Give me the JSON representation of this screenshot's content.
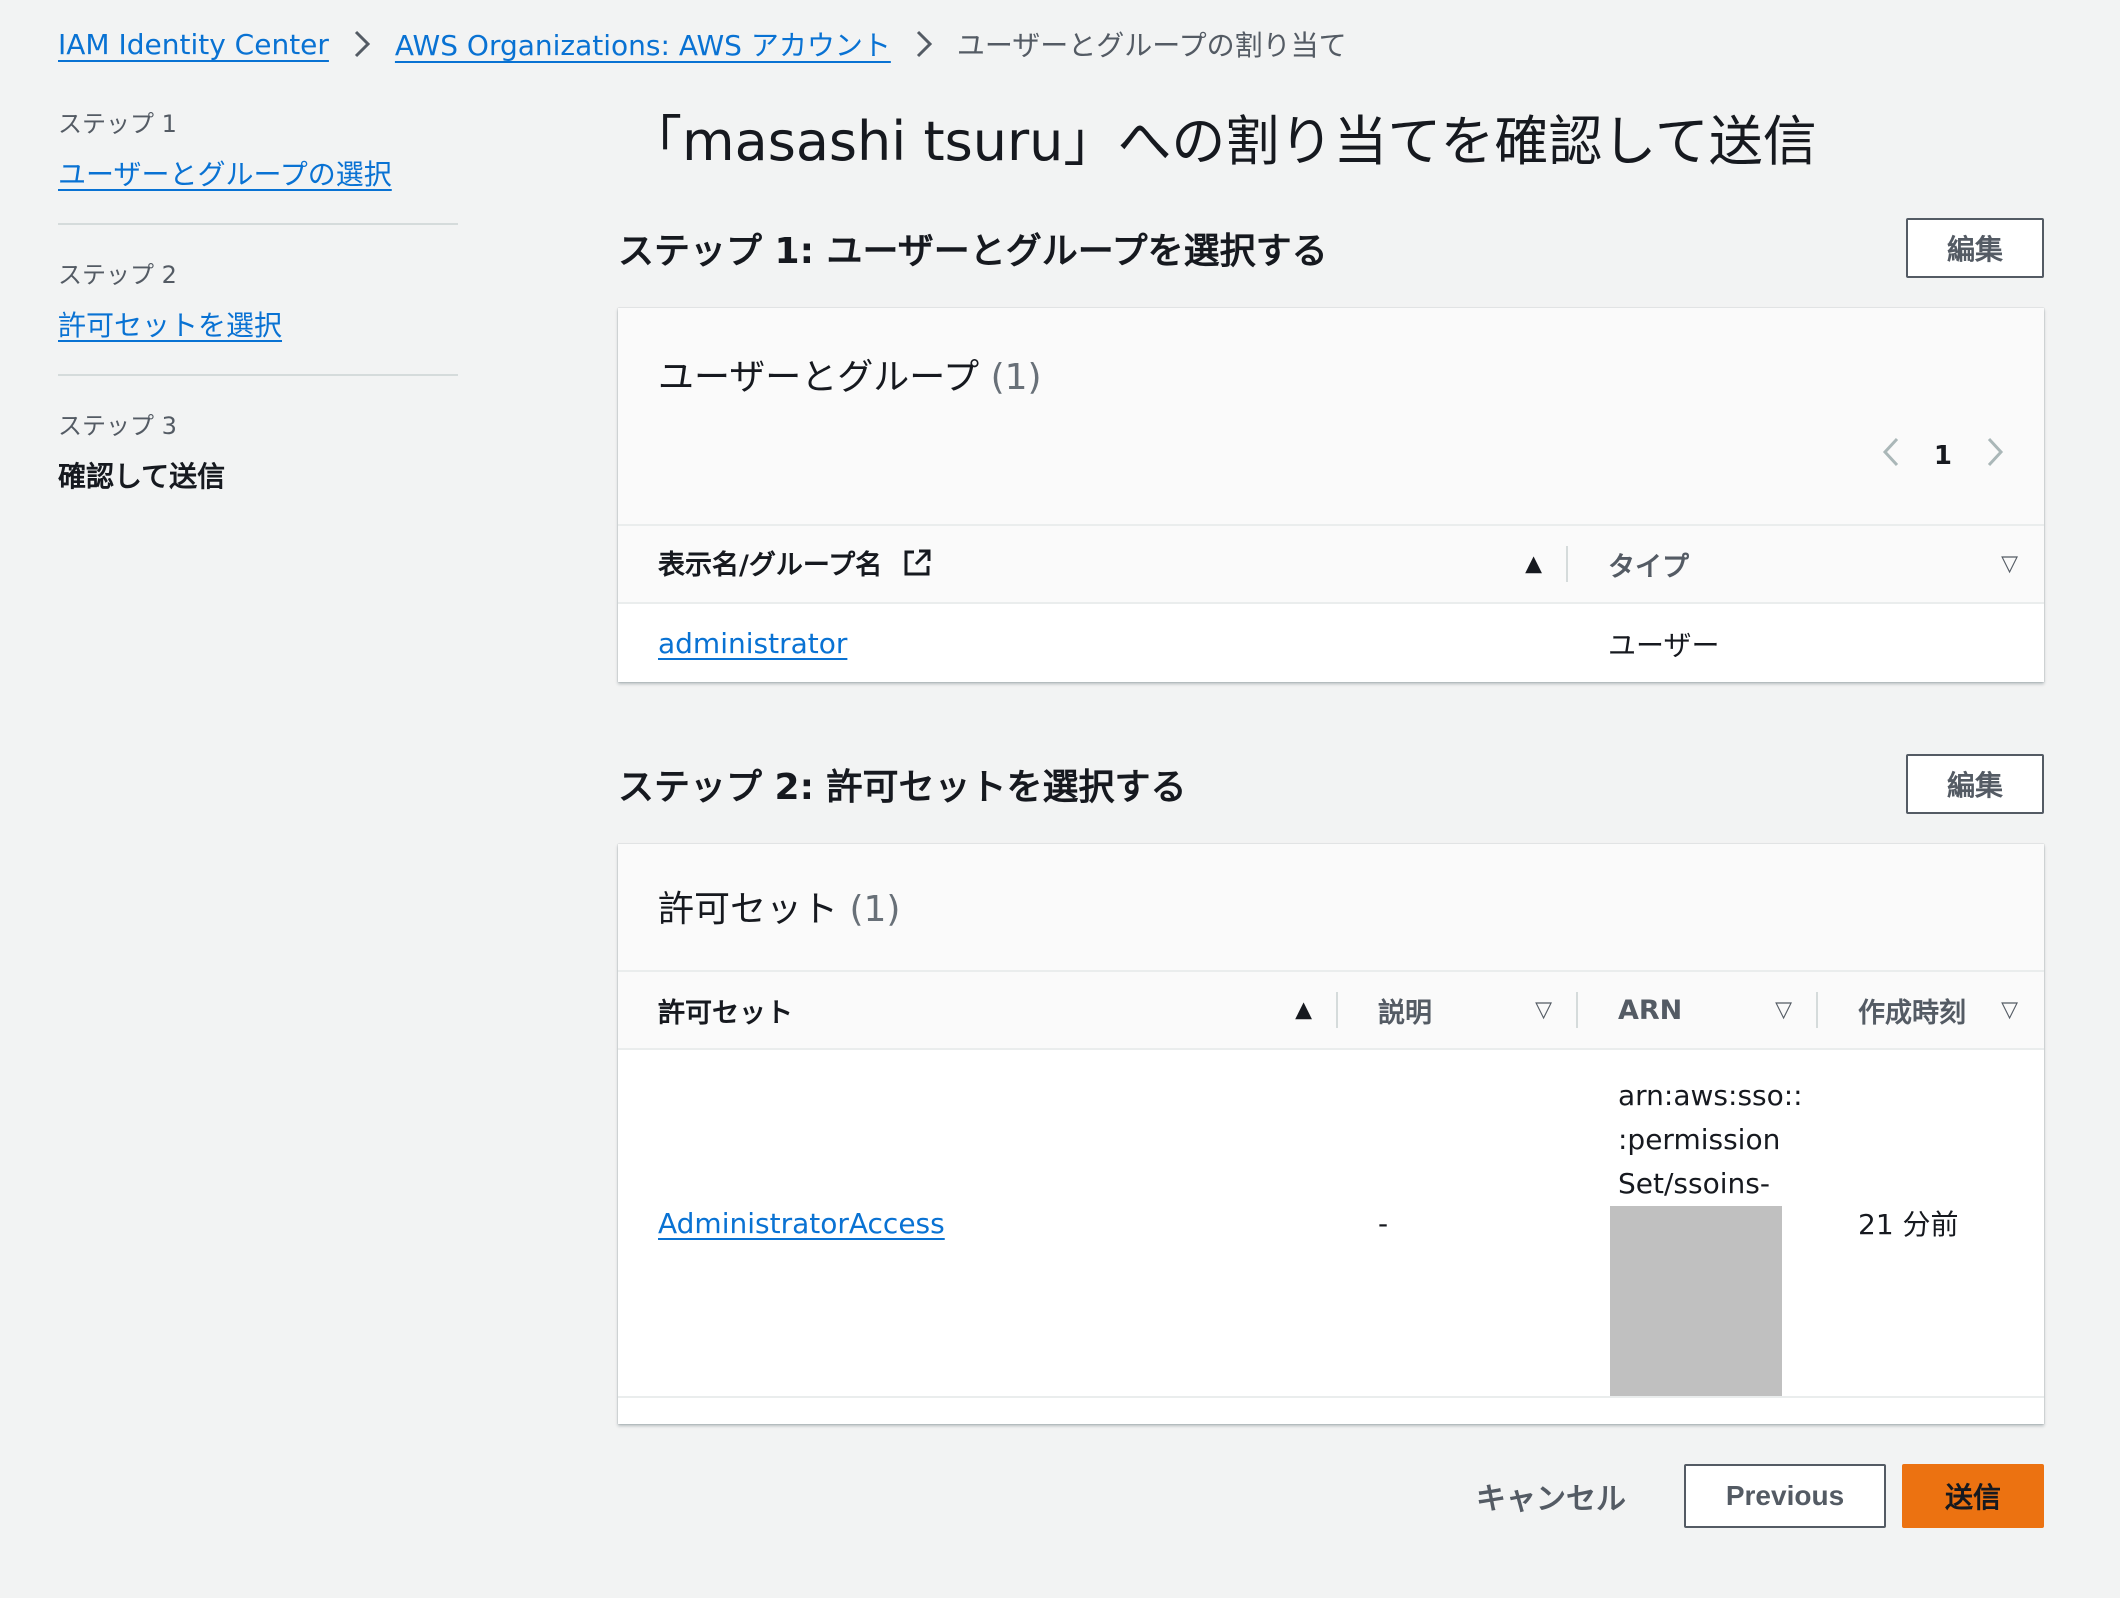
{
  "breadcrumb": {
    "items": [
      {
        "label": "IAM Identity Center"
      },
      {
        "label": "AWS Organizations: AWS アカウント"
      }
    ],
    "current": "ユーザーとグループの割り当て"
  },
  "sidenav": {
    "steps": [
      {
        "num": "ステップ 1",
        "label": "ユーザーとグループの選択"
      },
      {
        "num": "ステップ 2",
        "label": "許可セットを選択"
      },
      {
        "num": "ステップ 3",
        "label": "確認して送信"
      }
    ]
  },
  "page": {
    "title": "「masashi tsuru」への割り当てを確認して送信"
  },
  "section1": {
    "heading": "ステップ 1: ユーザーとグループを選択する",
    "edit_label": "編集",
    "panel_title": "ユーザーとグループ",
    "count": "(1)",
    "pager": {
      "page": "1"
    },
    "columns": [
      "表示名/グループ名",
      "タイプ"
    ],
    "rows": [
      {
        "name": "administrator",
        "type": "ユーザー"
      }
    ]
  },
  "section2": {
    "heading": "ステップ 2: 許可セットを選択する",
    "edit_label": "編集",
    "panel_title": "許可セット",
    "count": "(1)",
    "columns": [
      "許可セット",
      "説明",
      "ARN",
      "作成時刻"
    ],
    "rows": [
      {
        "name": "AdministratorAccess",
        "description": "-",
        "arn_lines": [
          "arn:aws:sso::",
          ":permission",
          "Set/ssoins-"
        ],
        "created": "21 分前"
      }
    ]
  },
  "footer": {
    "cancel": "キャンセル",
    "previous": "Previous",
    "submit": "送信"
  },
  "colors": {
    "link": "#0972d3",
    "primary_button": "#ec7211",
    "background": "#f2f3f3"
  }
}
